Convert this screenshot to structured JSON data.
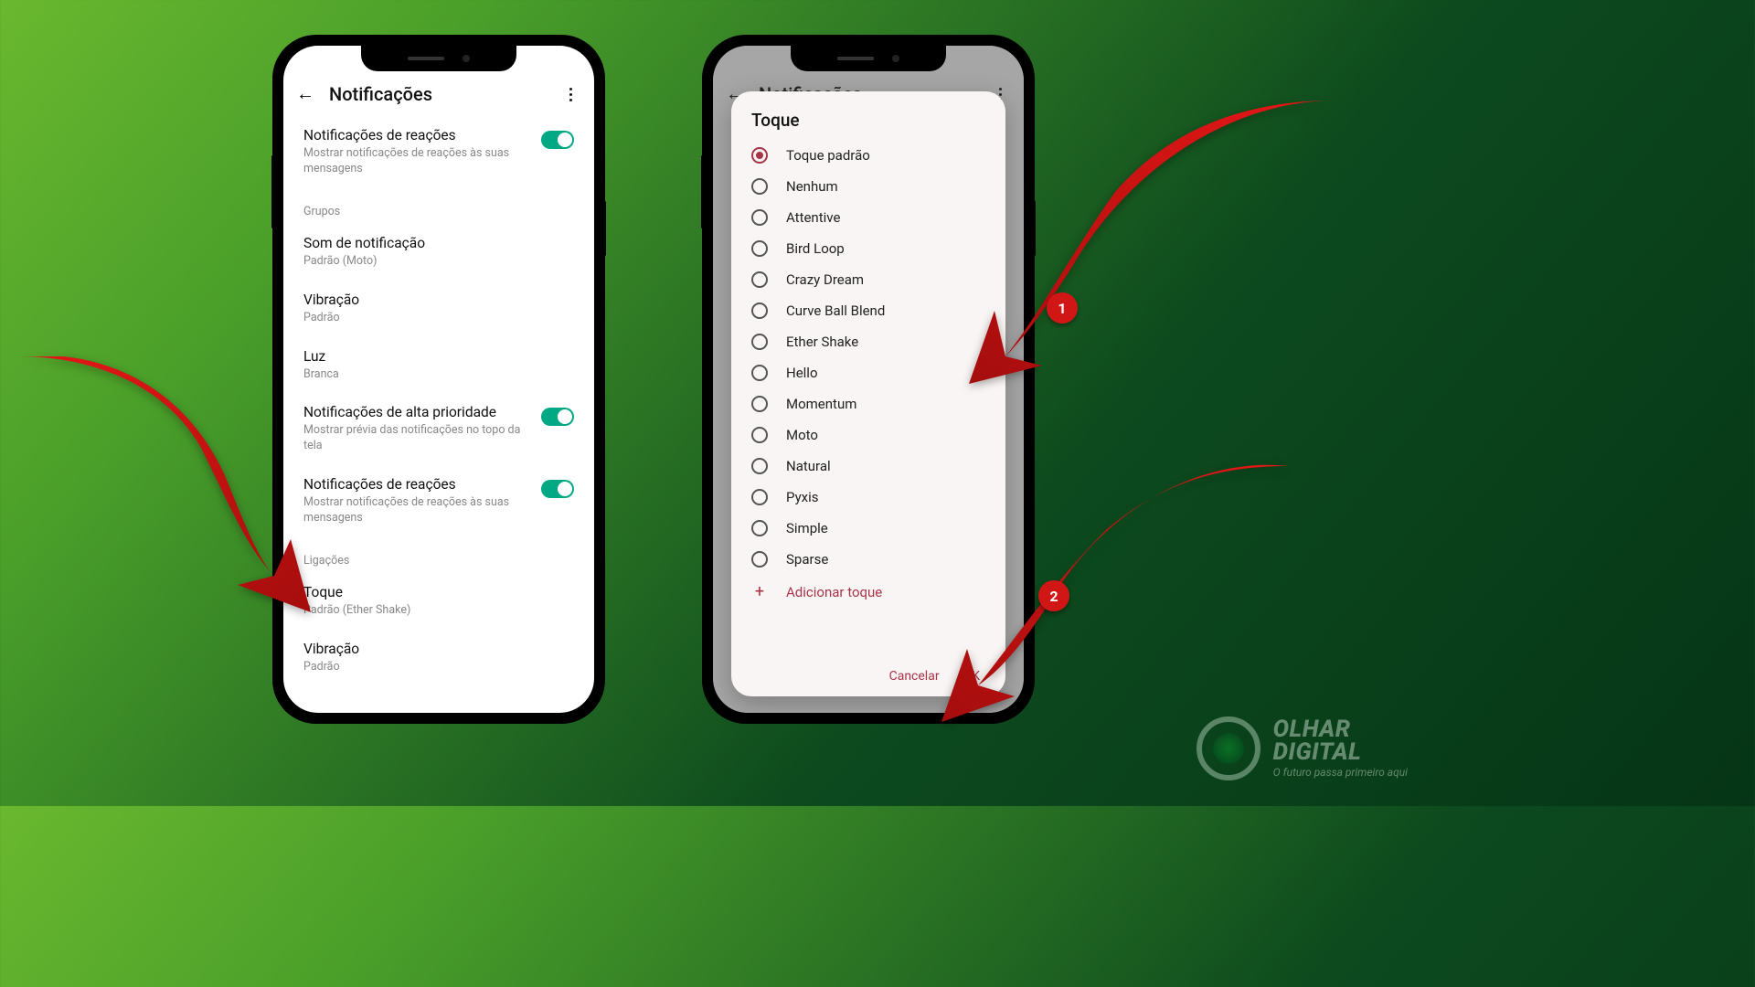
{
  "left": {
    "title": "Notificações",
    "rows": {
      "reac1_title": "Notificações de reações",
      "reac1_sub": "Mostrar notificações de reações às suas mensagens",
      "section_grupos": "Grupos",
      "som_title": "Som de notificação",
      "som_sub": "Padrão (Moto)",
      "vib_title": "Vibração",
      "vib_sub": "Padrão",
      "luz_title": "Luz",
      "luz_sub": "Branca",
      "prio_title": "Notificações de alta prioridade",
      "prio_sub": "Mostrar prévia das notificações no topo da tela",
      "reac2_title": "Notificações de reações",
      "reac2_sub": "Mostrar notificações de reações às suas mensagens",
      "section_ligacoes": "Ligações",
      "toque_title": "Toque",
      "toque_sub": "Padrão (Ether Shake)",
      "vib2_title": "Vibração",
      "vib2_sub": "Padrão"
    }
  },
  "dialog": {
    "title": "Toque",
    "options": {
      "o0": "Toque padrão",
      "o1": "Nenhum",
      "o2": "Attentive",
      "o3": "Bird Loop",
      "o4": "Crazy Dream",
      "o5": "Curve Ball Blend",
      "o6": "Ether Shake",
      "o7": "Hello",
      "o8": "Momentum",
      "o9": "Moto",
      "o10": "Natural",
      "o11": "Pyxis",
      "o12": "Simple",
      "o13": "Sparse"
    },
    "add": "Adicionar toque",
    "cancel": "Cancelar",
    "ok": "OK"
  },
  "badges": {
    "b1": "1",
    "b2": "2"
  },
  "watermark": {
    "line1": "OLHAR",
    "line2": "DIGITAL",
    "tagline": "O futuro passa primeiro aqui"
  }
}
